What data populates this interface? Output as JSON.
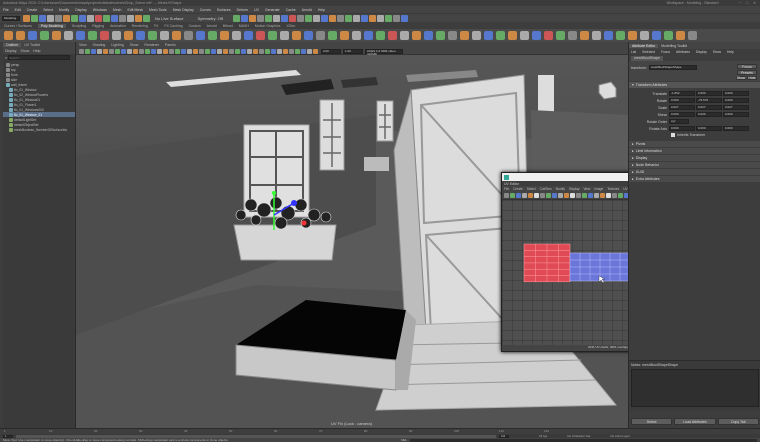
{
  "title_bar": {
    "text": "Autodesk Maya 2019: C:\\Users\\user\\Documents\\maya\\projects\\default\\scenes\\Shop_Scene.mb* --- MeshUVShape",
    "workspace_label": "Workspace : Modeling - Standard"
  },
  "main_menu": [
    "File",
    "Edit",
    "Create",
    "Select",
    "Modify",
    "Display",
    "Windows",
    "Mesh",
    "Edit Mesh",
    "Mesh Tools",
    "Mesh Display",
    "Curves",
    "Surfaces",
    "Deform",
    "UV",
    "Generate",
    "Cache",
    "Arnold",
    "Help"
  ],
  "mode_dropdown": "Modeling",
  "no_live_surface": "No Live Surface",
  "symmetry": "Symmetry: Off",
  "shelf_tabs": [
    "Curves / Surfaces",
    "Poly Modeling",
    "Sculpting",
    "Rigging",
    "Animation",
    "Rendering",
    "FX",
    "FX Caching",
    "Custom",
    "Arnold",
    "Bifrost",
    "MASH",
    "Motion Graphics",
    "XGen"
  ],
  "outliner": {
    "tabs": [
      "Outliner",
      "UV Toolkit"
    ],
    "menu": [
      "Display",
      "Show",
      "Help"
    ],
    "search_placeholder": "Search...",
    "items": [
      "persp",
      "top",
      "front",
      "side",
      "wall_frame",
      "flo_01_Window",
      "flo_02_WindowFlowers",
      "flo_01_Window01",
      "flo_01_Flower1",
      "flo_01_Windows003",
      "flo_01_Window_01",
      "defaultLightSet",
      "defaultObjectSet",
      "meshBoolean_NumberOfSurfaceIds"
    ]
  },
  "viewport": {
    "menu": [
      "View",
      "Shading",
      "Lighting",
      "Show",
      "Renderer",
      "Panels"
    ],
    "field1": "0.00",
    "field2": "1.00",
    "color_space": "ACES 1.0 SDR-video (sRGB)",
    "camera_label": "UV Fix (Lock : camera)"
  },
  "attribute_editor": {
    "title": "Attribute Editor",
    "tab2": "Modelling Toolkit",
    "menu": [
      "List",
      "Selected",
      "Focus",
      "Attributes",
      "Display",
      "Show",
      "Help"
    ],
    "node_tab": "meshBoolShape",
    "field_label": "transform:",
    "field_value": "meshBoolShapeShape",
    "focus_btn": "Focus",
    "presets_btn": "Presets",
    "show_btn": "Show",
    "hide_btn": "Hide",
    "section": "Transform Attributes",
    "rows": [
      {
        "label": "Translate",
        "v": [
          "-1.652",
          "0.000",
          "0.000"
        ]
      },
      {
        "label": "Rotate",
        "v": [
          "0.000",
          "-76.576",
          "0.000"
        ]
      },
      {
        "label": "Scale",
        "v": [
          "0.027",
          "0.027",
          "0.027"
        ]
      },
      {
        "label": "Shear",
        "v": [
          "0.000",
          "0.000",
          "0.000"
        ]
      },
      {
        "label": "Rotate Order",
        "v": [
          "xyz"
        ]
      },
      {
        "label": "Rotate Axis",
        "v": [
          "0.000",
          "0.000",
          "0.000"
        ]
      }
    ],
    "inherits": "Inherits Transform",
    "sections": [
      "Pivots",
      "Limit Information",
      "Display",
      "Node Behavior",
      "UUID",
      "Extra Attributes"
    ],
    "notes": "Notes: meshBoolShapeShape",
    "select_btn": "Select",
    "load_btn": "Load Attributes",
    "copy_btn": "Copy Tab"
  },
  "uv_editor": {
    "title": "UV Editor",
    "menu": [
      "File",
      "Create",
      "Select",
      "Cut/Sew",
      "Modify",
      "Display",
      "View",
      "Image",
      "Textures",
      "UV Sets",
      "Help"
    ],
    "status": "2041 UV shells, 3091 overlapping UVs, 0000 reversed UVs",
    "toolkit": {
      "title": "UV Toolkit",
      "menu": [
        "Options",
        "Help"
      ],
      "sections": [
        "Symmetry",
        "Align and Snap"
      ],
      "pin_selection": "Pin Selection",
      "unpin": "Unpin",
      "linked": "Linked",
      "straighten_uvs": "Straighten UVs",
      "straighten_shell": "Straighten Shell",
      "align_label": "Align",
      "linear_align": "Linear Align",
      "snap_label": "Snap",
      "snap_together": "Snap Together",
      "snap_and_stack": "Snap and Stack",
      "match_grid": "Match Grid",
      "match_uvs": "Match UVs",
      "normalize": "Normalize",
      "uv_sets_label": "UV Sets"
    }
  },
  "timeline": {
    "numbers": [
      "1",
      "10",
      "20",
      "30",
      "40",
      "50",
      "60",
      "70",
      "80",
      "90",
      "100",
      "110",
      "120"
    ],
    "range_start": "1",
    "range_end": "120",
    "fps": "24 fps",
    "character_set": "No Character Set",
    "anim_layer": "No Anim Layer"
  },
  "help_line": "Move Tool: Use manipulator to move object(s). Ctrl+middle-drag to move components along normals. Shift+drag manipulator axis to extrude components or clone objects.",
  "mel_label": "MEL"
}
